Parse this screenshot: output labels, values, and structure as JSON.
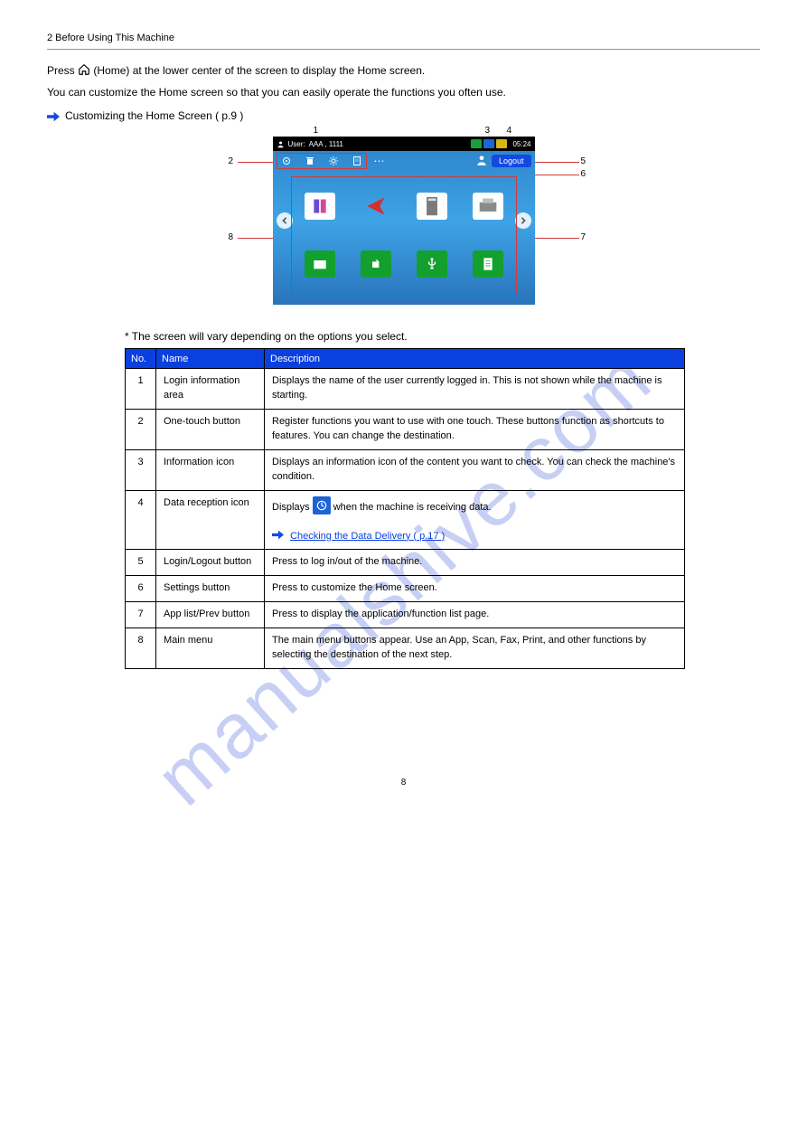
{
  "header": "2 Before Using This Machine",
  "intro1_a": "Press ",
  "intro1_b": " (Home) at the lower center of the screen to display the Home screen.",
  "intro2": "You can customize the Home screen so that you can easily operate the functions you often use.",
  "reference_text": "Customizing the Home Screen ( p.9 )",
  "screenshot": {
    "user_label": "User:",
    "user_value": "AAA , 1111",
    "time": "05:24",
    "logout": "Logout"
  },
  "callouts": {
    "c1": "1",
    "c2": "2",
    "c3": "3",
    "c4": "4",
    "c5": "5",
    "c6": "6",
    "c7": "7",
    "c8": "8"
  },
  "table_title": "* The screen will vary depending on the options you select.",
  "table": {
    "head": {
      "no": "No.",
      "name": "Name",
      "desc": "Description"
    },
    "rows": [
      {
        "no": "1",
        "name": "Login information area",
        "desc": "Displays the name of the user currently logged in. This is not shown while the machine is starting."
      },
      {
        "no": "2",
        "name": "One-touch button",
        "desc": "Register functions you want to use with one touch. These buttons function as shortcuts to features. You can change the destination."
      },
      {
        "no": "3",
        "name": "Information icon",
        "desc": "Displays an information icon of the content you want to check. You can check the machine's condition."
      },
      {
        "no": "4",
        "name": "Data reception icon",
        "desc_a": "Displays ",
        "desc_b": " when the machine is receiving data.",
        "desc_ref": "Checking the Data Delivery ( p.17 )"
      },
      {
        "no": "5",
        "name": "Login/Logout button",
        "desc": "Press to log in/out of the machine."
      },
      {
        "no": "6",
        "name": "Settings button",
        "desc": "Press to customize the Home screen."
      },
      {
        "no": "7",
        "name": "App list/Prev button",
        "desc": "Press to display the application/function list page."
      },
      {
        "no": "8",
        "name": "Main menu",
        "desc": "The main menu buttons appear. Use an App, Scan, Fax, Print, and other functions by selecting the destination of the next step."
      }
    ]
  },
  "footer": "8",
  "watermark": "manualshive.com"
}
